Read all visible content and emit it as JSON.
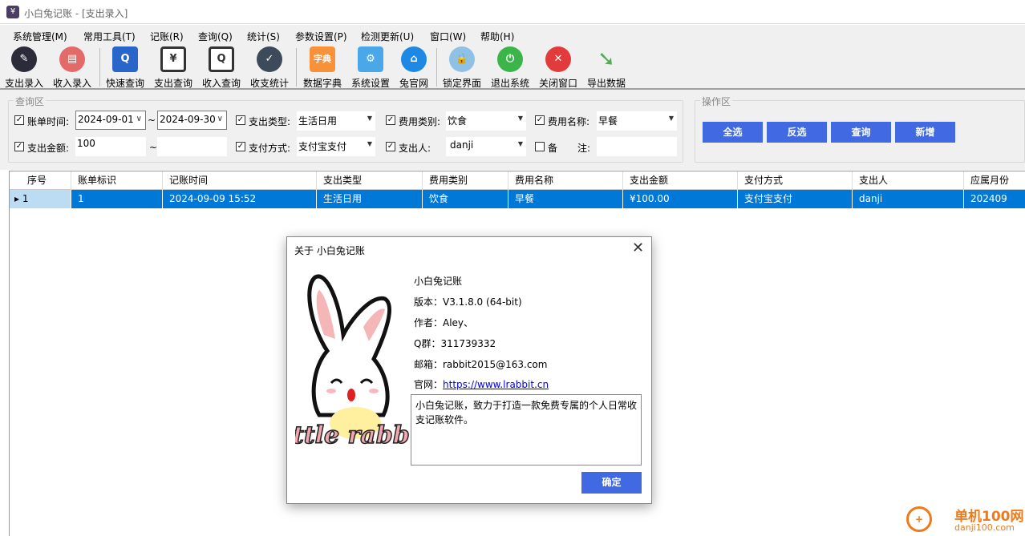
{
  "window": {
    "title": "小白兔记账 - [支出录入]",
    "icon": "yen-icon"
  },
  "menu": [
    "系统管理(M)",
    "常用工具(T)",
    "记账(R)",
    "查询(Q)",
    "统计(S)",
    "参数设置(P)",
    "检测更新(U)",
    "窗口(W)",
    "帮助(H)"
  ],
  "toolbar": [
    {
      "label": "支出录入",
      "icon": "expense-entry-icon",
      "color": "#2b2b3a"
    },
    {
      "label": "收入录入",
      "icon": "income-entry-icon",
      "color": "#e46a6a"
    },
    {
      "label": "快速查询",
      "icon": "quick-search-icon",
      "color": "#2a66c9"
    },
    {
      "label": "支出查询",
      "icon": "expense-search-icon",
      "color": "#ffffff"
    },
    {
      "label": "收入查询",
      "icon": "income-search-icon",
      "color": "#ffffff"
    },
    {
      "label": "收支统计",
      "icon": "statistics-icon",
      "color": "#3c4a5a"
    },
    {
      "label": "数据字典",
      "icon": "dictionary-icon",
      "color": "#f7923a",
      "text": "字典"
    },
    {
      "label": "系统设置",
      "icon": "gear-icon",
      "color": "#4aa8e8"
    },
    {
      "label": "兔官网",
      "icon": "home-icon",
      "color": "#1e88e5"
    },
    {
      "label": "锁定界面",
      "icon": "lock-icon",
      "color": "#8fc1e6"
    },
    {
      "label": "退出系统",
      "icon": "power-icon",
      "color": "#3bb54a"
    },
    {
      "label": "关闭窗口",
      "icon": "close-icon",
      "color": "#e23b3b"
    },
    {
      "label": "导出数据",
      "icon": "export-arrow-icon",
      "color": "#4caf50"
    }
  ],
  "query": {
    "title": "查询区",
    "bill_time": {
      "label": "账单时间:",
      "checked": true,
      "from": "2024-09-01",
      "to": "2024-09-30",
      "sep": "~"
    },
    "expense_type": {
      "label": "支出类型:",
      "checked": true,
      "value": "生活日用"
    },
    "fee_category": {
      "label": "费用类别:",
      "checked": true,
      "value": "饮食"
    },
    "fee_name": {
      "label": "费用名称:",
      "checked": true,
      "value": "早餐"
    },
    "amount": {
      "label": "支出金额:",
      "checked": true,
      "from": "100",
      "to": "",
      "sep": "~"
    },
    "pay_method": {
      "label": "支付方式:",
      "checked": true,
      "value": "支付宝支付"
    },
    "payer": {
      "label": "支出人:",
      "checked": true,
      "value": "danji"
    },
    "note": {
      "label1": "备",
      "label2": "注:",
      "checked": false,
      "value": ""
    }
  },
  "ops": {
    "title": "操作区",
    "buttons": [
      "全选",
      "反选",
      "查询",
      "新增"
    ],
    "color": "#4169e1"
  },
  "table": {
    "columns": [
      "序号",
      "账单标识",
      "记账时间",
      "支出类型",
      "费用类别",
      "费用名称",
      "支出金额",
      "支付方式",
      "支出人",
      "应属月份"
    ],
    "rows": [
      [
        "1",
        "1",
        "2024-09-09 15:52",
        "生活日用",
        "饮食",
        "早餐",
        "¥100.00",
        "支付宝支付",
        "danji",
        "202409"
      ]
    ]
  },
  "about": {
    "title": "关于 小白兔记账",
    "app_name": "小白兔记账",
    "version": "版本：V3.1.8.0 (64-bit)",
    "author": "作者：Aley、",
    "qq_label": "Q群：",
    "qq": "311739332",
    "email": "邮箱：rabbit2015@163.com",
    "site_label": "官网：",
    "site": "https://www.lrabbit.cn",
    "description": "小白兔记账，致力于打造一款免费专属的个人日常收支记账软件。",
    "logo_text": "little rabbit",
    "ok": "确定"
  },
  "watermark": {
    "name": "单机100网",
    "url": "danji100.com"
  }
}
